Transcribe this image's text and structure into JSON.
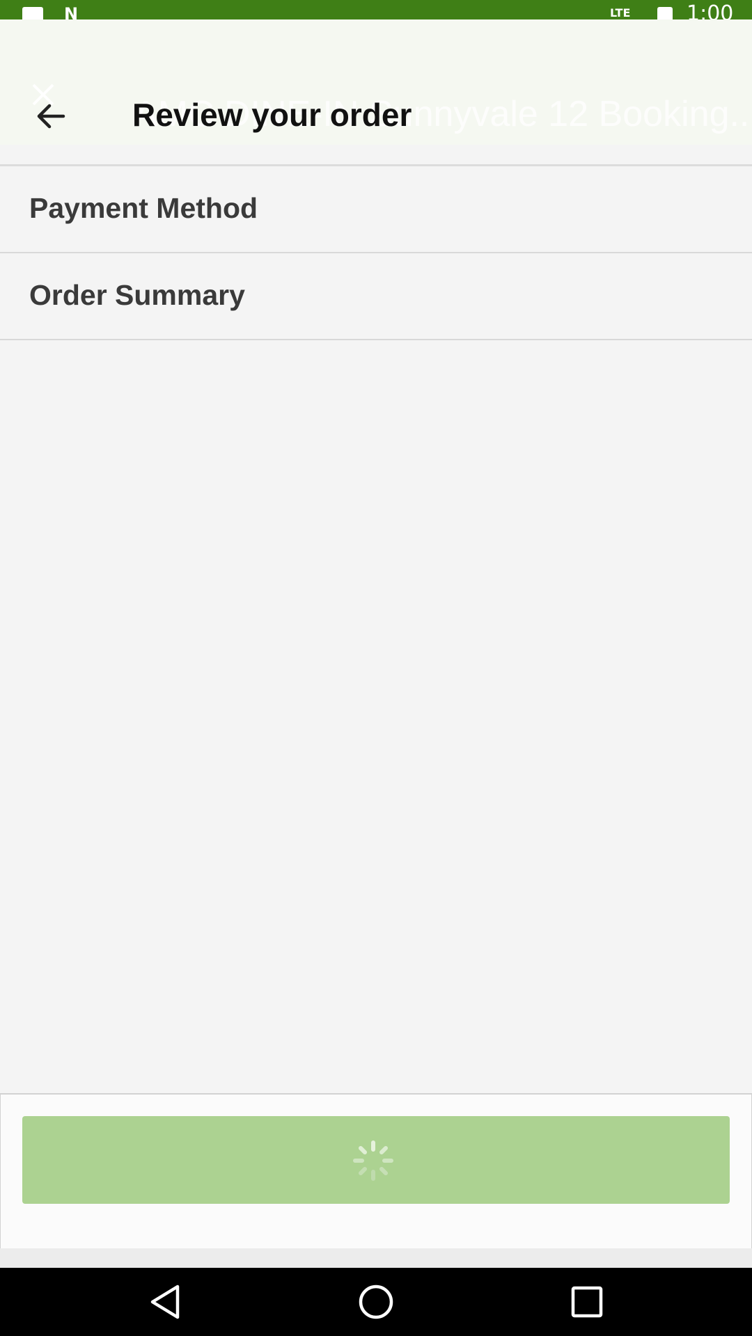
{
  "status_bar": {
    "lte_label": "LTE",
    "time": "1:00",
    "color": "#3f7f16"
  },
  "background_page": {
    "title": "AMC DINE-IN Sunnyvale 12 Booking..."
  },
  "toolbar": {
    "back_icon": "arrow-left-icon",
    "title": "Review your order"
  },
  "sections": [
    {
      "label": "Payment Method"
    },
    {
      "label": "Order Summary"
    }
  ],
  "primary_button": {
    "state": "loading",
    "color": "#acd291",
    "spinner_icon": "loading-spinner-icon"
  },
  "nav_bar": {
    "back_icon": "triangle-back-icon",
    "home_icon": "circle-home-icon",
    "recents_icon": "square-recents-icon"
  }
}
